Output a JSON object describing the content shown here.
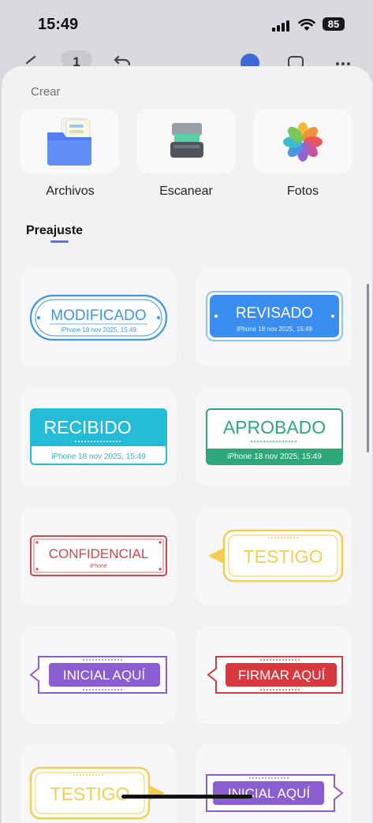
{
  "status_bar": {
    "time": "15:49",
    "battery": "85"
  },
  "nav": {
    "page_indicator": "1"
  },
  "create": {
    "title": "Crear",
    "items": [
      {
        "label": "Archivos",
        "icon": "folder-icon"
      },
      {
        "label": "Escanear",
        "icon": "scanner-icon"
      },
      {
        "label": "Fotos",
        "icon": "photos-icon"
      }
    ]
  },
  "presets": {
    "tab_label": "Preajuste",
    "stamps": [
      {
        "text": "MODIFICADO",
        "subtext": "iPhone 18 nov 2025, 15:49",
        "color": "#3b97e0"
      },
      {
        "text": "REVISADO",
        "subtext": "iPhone 18 nov 2025, 15:49",
        "color": "#3a8ef0"
      },
      {
        "text": "RECIBIDO",
        "subtext": "iPhone 18 nov 2025, 15:49",
        "color": "#25bcd8"
      },
      {
        "text": "APROBADO",
        "subtext": "iPhone 18 nov 2025, 15:49",
        "color": "#2ea87a"
      },
      {
        "text": "CONFIDENCIAL",
        "subtext": "iPhone",
        "color": "#d0454a"
      },
      {
        "text": "TESTIGO",
        "subtext": "",
        "color": "#f3cd52"
      },
      {
        "text": "INICIAL AQUÍ",
        "subtext": "",
        "color": "#8a5ed0"
      },
      {
        "text": "FIRMAR AQUÍ",
        "subtext": "",
        "color": "#d8393f"
      },
      {
        "text": "TESTIGO",
        "subtext": "",
        "color": "#f3cd52"
      },
      {
        "text": "INICIAL AQUÍ",
        "subtext": "",
        "color": "#8a5ed0"
      }
    ]
  }
}
